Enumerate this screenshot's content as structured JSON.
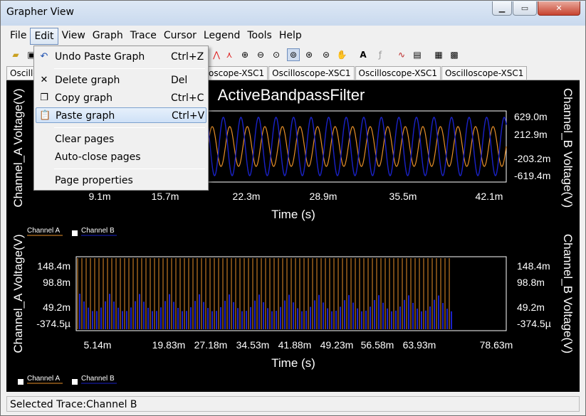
{
  "window": {
    "title": "Grapher View"
  },
  "menu": [
    "File",
    "Edit",
    "View",
    "Graph",
    "Trace",
    "Cursor",
    "Legend",
    "Tools",
    "Help"
  ],
  "tabs": [
    "Oscillo",
    "oscope-XSC1",
    "Oscilloscope-XSC1",
    "Oscilloscope-XSC1",
    "Oscilloscope-XSC1"
  ],
  "edit_menu": {
    "undo": {
      "label": "Undo Paste Graph",
      "shortcut": "Ctrl+Z"
    },
    "delete": {
      "label": "Delete graph",
      "shortcut": "Del"
    },
    "copy": {
      "label": "Copy graph",
      "shortcut": "Ctrl+C"
    },
    "paste": {
      "label": "Paste graph",
      "shortcut": "Ctrl+V"
    },
    "clear": {
      "label": "Clear pages"
    },
    "autoclose": {
      "label": "Auto-close pages"
    },
    "props": {
      "label": "Page properties"
    }
  },
  "graph1": {
    "title": "ActiveBandpassFilter",
    "ylabel_left": "Channel_A Voltage(V)",
    "ylabel_right": "Channel_B Voltage(V)",
    "xlabel": "Time (s)",
    "xticks": [
      "9.1m",
      "15.7m",
      "22.3m",
      "28.9m",
      "35.5m",
      "42.1m"
    ],
    "yticks_right": [
      "629.0m",
      "212.9m",
      "-203.2m",
      "-619.4m"
    ],
    "legend": [
      "Channel A",
      "Channel B"
    ]
  },
  "graph2": {
    "ylabel_left": "Channel_A Voltage(V)",
    "ylabel_right": "Channel_B Voltage(V)",
    "xlabel": "Time (s)",
    "xticks": [
      "5.14m",
      "19.83m",
      "27.18m",
      "34.53m",
      "41.88m",
      "49.23m",
      "56.58m",
      "63.93m",
      "78.63m"
    ],
    "yticks_left": [
      "148.4m",
      "98.8m",
      "49.2m",
      "-374.5µ"
    ],
    "yticks_right": [
      "148.4m",
      "98.8m",
      "49.2m",
      "-374.5µ"
    ],
    "legend": [
      "Channel A",
      "Channel B"
    ]
  },
  "status": {
    "text": "Selected Trace:Channel B"
  },
  "colors": {
    "channel_a": "#e8902a",
    "channel_b": "#1a22c8",
    "bg": "#000000",
    "fg": "#ffffff"
  }
}
